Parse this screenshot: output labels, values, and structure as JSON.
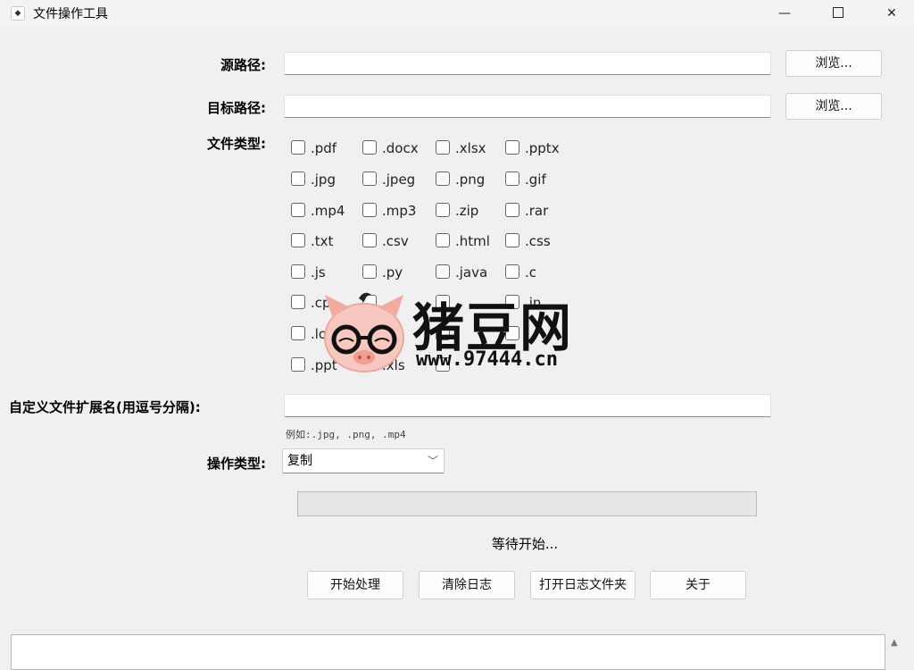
{
  "window": {
    "title": "文件操作工具",
    "app_icon": "app-icon",
    "controls": {
      "minimize": "—",
      "close": "✕"
    }
  },
  "source": {
    "label": "源路径:",
    "value": "",
    "browse_label": "浏览..."
  },
  "target": {
    "label": "目标路径:",
    "value": "",
    "browse_label": "浏览..."
  },
  "file_types": {
    "label": "文件类型:",
    "items": [
      {
        "label": ".pdf",
        "checked": false
      },
      {
        "label": ".docx",
        "checked": false
      },
      {
        "label": ".xlsx",
        "checked": false
      },
      {
        "label": ".pptx",
        "checked": false
      },
      {
        "label": ".jpg",
        "checked": false
      },
      {
        "label": ".jpeg",
        "checked": false
      },
      {
        "label": ".png",
        "checked": false
      },
      {
        "label": ".gif",
        "checked": false
      },
      {
        "label": ".mp4",
        "checked": false
      },
      {
        "label": ".mp3",
        "checked": false
      },
      {
        "label": ".zip",
        "checked": false
      },
      {
        "label": ".rar",
        "checked": false
      },
      {
        "label": ".txt",
        "checked": false
      },
      {
        "label": ".csv",
        "checked": false
      },
      {
        "label": ".html",
        "checked": false
      },
      {
        "label": ".css",
        "checked": false
      },
      {
        "label": ".js",
        "checked": false
      },
      {
        "label": ".py",
        "checked": false
      },
      {
        "label": ".java",
        "checked": false
      },
      {
        "label": ".c",
        "checked": false
      },
      {
        "label": ".cp",
        "checked": false
      },
      {
        "label": "",
        "checked": false
      },
      {
        "label": "",
        "checked": false
      },
      {
        "label": ".in",
        "checked": false
      },
      {
        "label": ".lo",
        "checked": false
      },
      {
        "label": "",
        "checked": false
      },
      {
        "label": "",
        "checked": false
      },
      {
        "label": "",
        "checked": false
      },
      {
        "label": ".ppt",
        "checked": false
      },
      {
        "label": ".xls",
        "checked": false
      },
      {
        "label": "",
        "checked": false
      }
    ]
  },
  "custom_ext": {
    "label": "自定义文件扩展名(用逗号分隔):",
    "value": "",
    "hint": "例如:.jpg, .png, .mp4"
  },
  "operation": {
    "label": "操作类型:",
    "selected": "复制"
  },
  "progress": {
    "value": 0
  },
  "status_text": "等待开始...",
  "buttons": {
    "start": "开始处理",
    "clear_log": "清除日志",
    "open_log_folder": "打开日志文件夹",
    "about": "关于"
  },
  "watermark": {
    "brand": "猪豆网",
    "url": "www.97444.cn"
  }
}
